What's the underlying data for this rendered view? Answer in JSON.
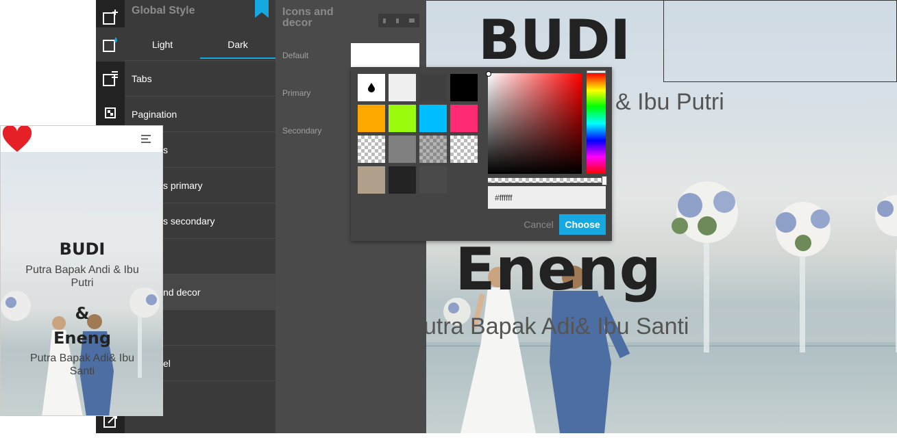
{
  "panel": {
    "title": "Global Style",
    "themes": [
      "Light",
      "Dark"
    ],
    "selected_theme": "Dark",
    "items": [
      "Tabs",
      "Pagination",
      "s",
      "s primary",
      "s secondary",
      "",
      "nd decor",
      "",
      "el",
      ""
    ]
  },
  "subpanel": {
    "title": "Icons and decor",
    "labels": [
      "Default",
      "Primary",
      "Secondary"
    ]
  },
  "picker": {
    "hex_value": "#ffffff",
    "cancel_label": "Cancel",
    "choose_label": "Choose",
    "swatch_colors": [
      "#ffffff",
      "#f0f0f0",
      "#404040",
      "#000000",
      "#ffa800",
      "#9bfb0d",
      "#00bfff",
      "#ff2a74",
      "checker",
      "#808080",
      "checker-light",
      "checker",
      "#b1a18c",
      "#232323",
      "#4a4a4a"
    ]
  },
  "preview": {
    "name1": "BUDI",
    "parents1": "& Ibu Putri",
    "name2": "Eneng",
    "parents2": "utra Bapak Adi& Ibu Santi"
  },
  "mobile": {
    "name1": "BUDI",
    "parents1": "Putra Bapak Andi & Ibu Putri",
    "amp": "&",
    "name2": "Eneng",
    "parents2": "Putra Bapak Adi& Ibu Santi"
  },
  "colors": {
    "accent": "#16a9e1",
    "heart": "#e52026"
  }
}
